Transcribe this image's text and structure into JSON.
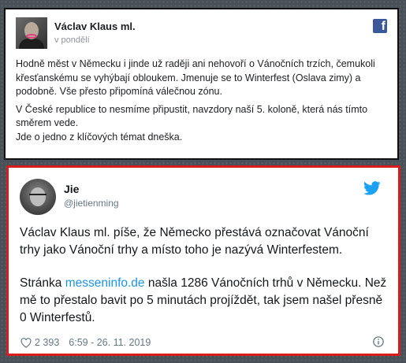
{
  "facebook_post": {
    "author": "Václav Klaus ml.",
    "time": "v pondělí",
    "logo_letter": "f",
    "paragraphs": [
      "Hodně měst v Německu i jinde už raději ani nehovoří o Vánočních trzích, čemukoli křesťanskému se vyhýbají obloukem. Jmenuje se to Winterfest (Oslava zimy) a podobně. Vše přesto připomíná válečnou zónu.",
      "V České republice to nesmíme připustit, navzdory naší 5. koloně, která nás tímto směrem vede.",
      "Jde o jedno z klíčových témat dneška."
    ]
  },
  "tweet": {
    "name": "Jie",
    "handle": "@jietienming",
    "paragraph1": "Václav Klaus ml. píše, že Německo přestává označovat Vánoční trhy jako Vánoční trhy a místo toho je nazývá Winterfestem.",
    "p2_before": "Stránka ",
    "p2_link": "messeninfo.de",
    "p2_after": " našla 1286 Vánočních trhů v Německu. Než mě to přestalo bavit po 5 minutách projíždět, tak jsem našel přesně 0 Winterfestů.",
    "likes": "2 393",
    "datetime": "6:59 - 26. 11. 2019"
  },
  "colors": {
    "facebook_blue": "#3b5998",
    "twitter_blue": "#1da1f2",
    "highlight_border": "#d81b1b",
    "link": "#1b95e0"
  },
  "icons": {
    "facebook": "facebook-logo-icon",
    "twitter": "twitter-bird-icon",
    "like": "heart-icon",
    "info": "info-icon"
  }
}
